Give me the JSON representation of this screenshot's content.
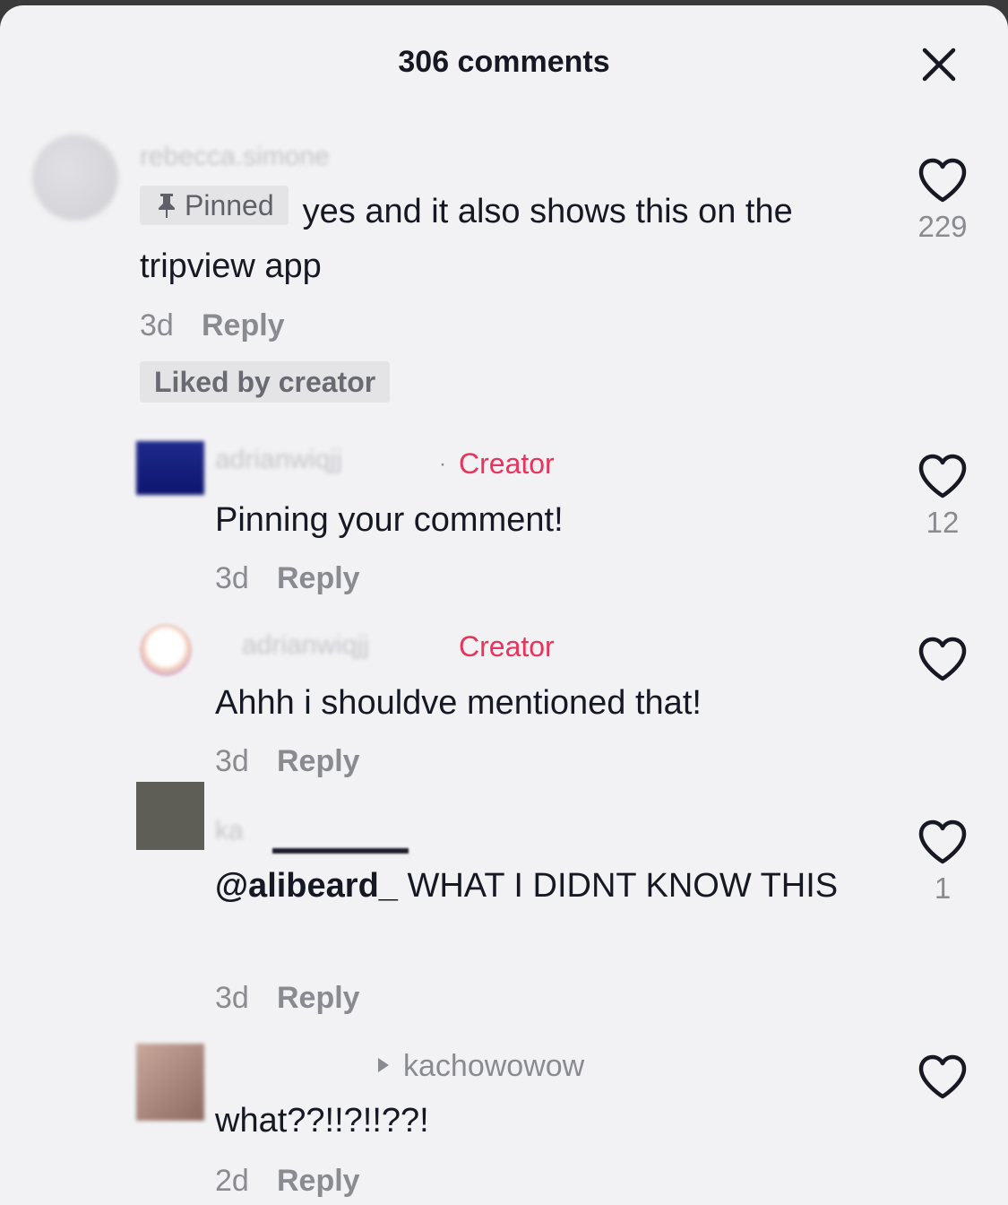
{
  "header": {
    "title": "306 comments"
  },
  "comments": [
    {
      "username": "rebecca.simone",
      "pinned_label": "Pinned",
      "text": "yes and it also shows this on the tripview app",
      "time": "3d",
      "reply_label": "Reply",
      "liked_by_creator": "Liked by creator",
      "likes": "229"
    },
    {
      "username": "adrianwiqjj",
      "creator_label": "Creator",
      "text": "Pinning your comment!",
      "time": "3d",
      "reply_label": "Reply",
      "likes": "12"
    },
    {
      "username": "adrianwiqjj",
      "creator_label": "Creator",
      "text": "Ahhh i shouldve mentioned that!",
      "time": "3d",
      "reply_label": "Reply",
      "likes": ""
    },
    {
      "username": "ka",
      "mention": "@alibeard_",
      "text": " WHAT I DIDNT KNOW THIS",
      "time": "3d",
      "reply_label": "Reply",
      "likes": "1"
    },
    {
      "reply_to": "kachowowow",
      "text": "what??!!?!!??!",
      "time": "2d",
      "reply_label": "Reply",
      "likes": ""
    }
  ],
  "icons": {
    "close": "close-icon",
    "like": "heart-outline-icon",
    "pin": "pin-icon",
    "reply_arrow": "caret-right-icon"
  },
  "colors": {
    "sheet": "#f2f2f4",
    "creator": "#e8335d",
    "muted": "#8a8b91",
    "text": "#161823"
  }
}
